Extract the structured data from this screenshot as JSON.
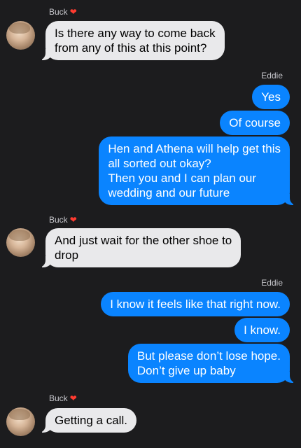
{
  "colors": {
    "background": "#1c1c1e",
    "incoming_bubble": "#e9e9eb",
    "outgoing_bubble": "#0a84ff",
    "heart": "#ff3b30"
  },
  "groups": [
    {
      "sender": "Buck",
      "icon": "red-heart-icon",
      "heart": "❤",
      "messages": [
        "Is there any way to come back\nfrom any of this at this point?"
      ]
    },
    {
      "sender": "Eddie",
      "messages": [
        "Yes",
        "Of course",
        "Hen and Athena will help get this\nall sorted out okay?\nThen you and I can plan our\nwedding and our future"
      ]
    },
    {
      "sender": "Buck",
      "icon": "red-heart-icon",
      "heart": "❤",
      "messages": [
        "And just wait for the other shoe to\ndrop"
      ]
    },
    {
      "sender": "Eddie",
      "messages": [
        "I know it feels like that right now.",
        "I know.",
        "But please don’t lose hope.\nDon’t give up baby"
      ]
    },
    {
      "sender": "Buck",
      "icon": "red-heart-icon",
      "heart": "❤",
      "messages": [
        "Getting a call."
      ]
    }
  ]
}
